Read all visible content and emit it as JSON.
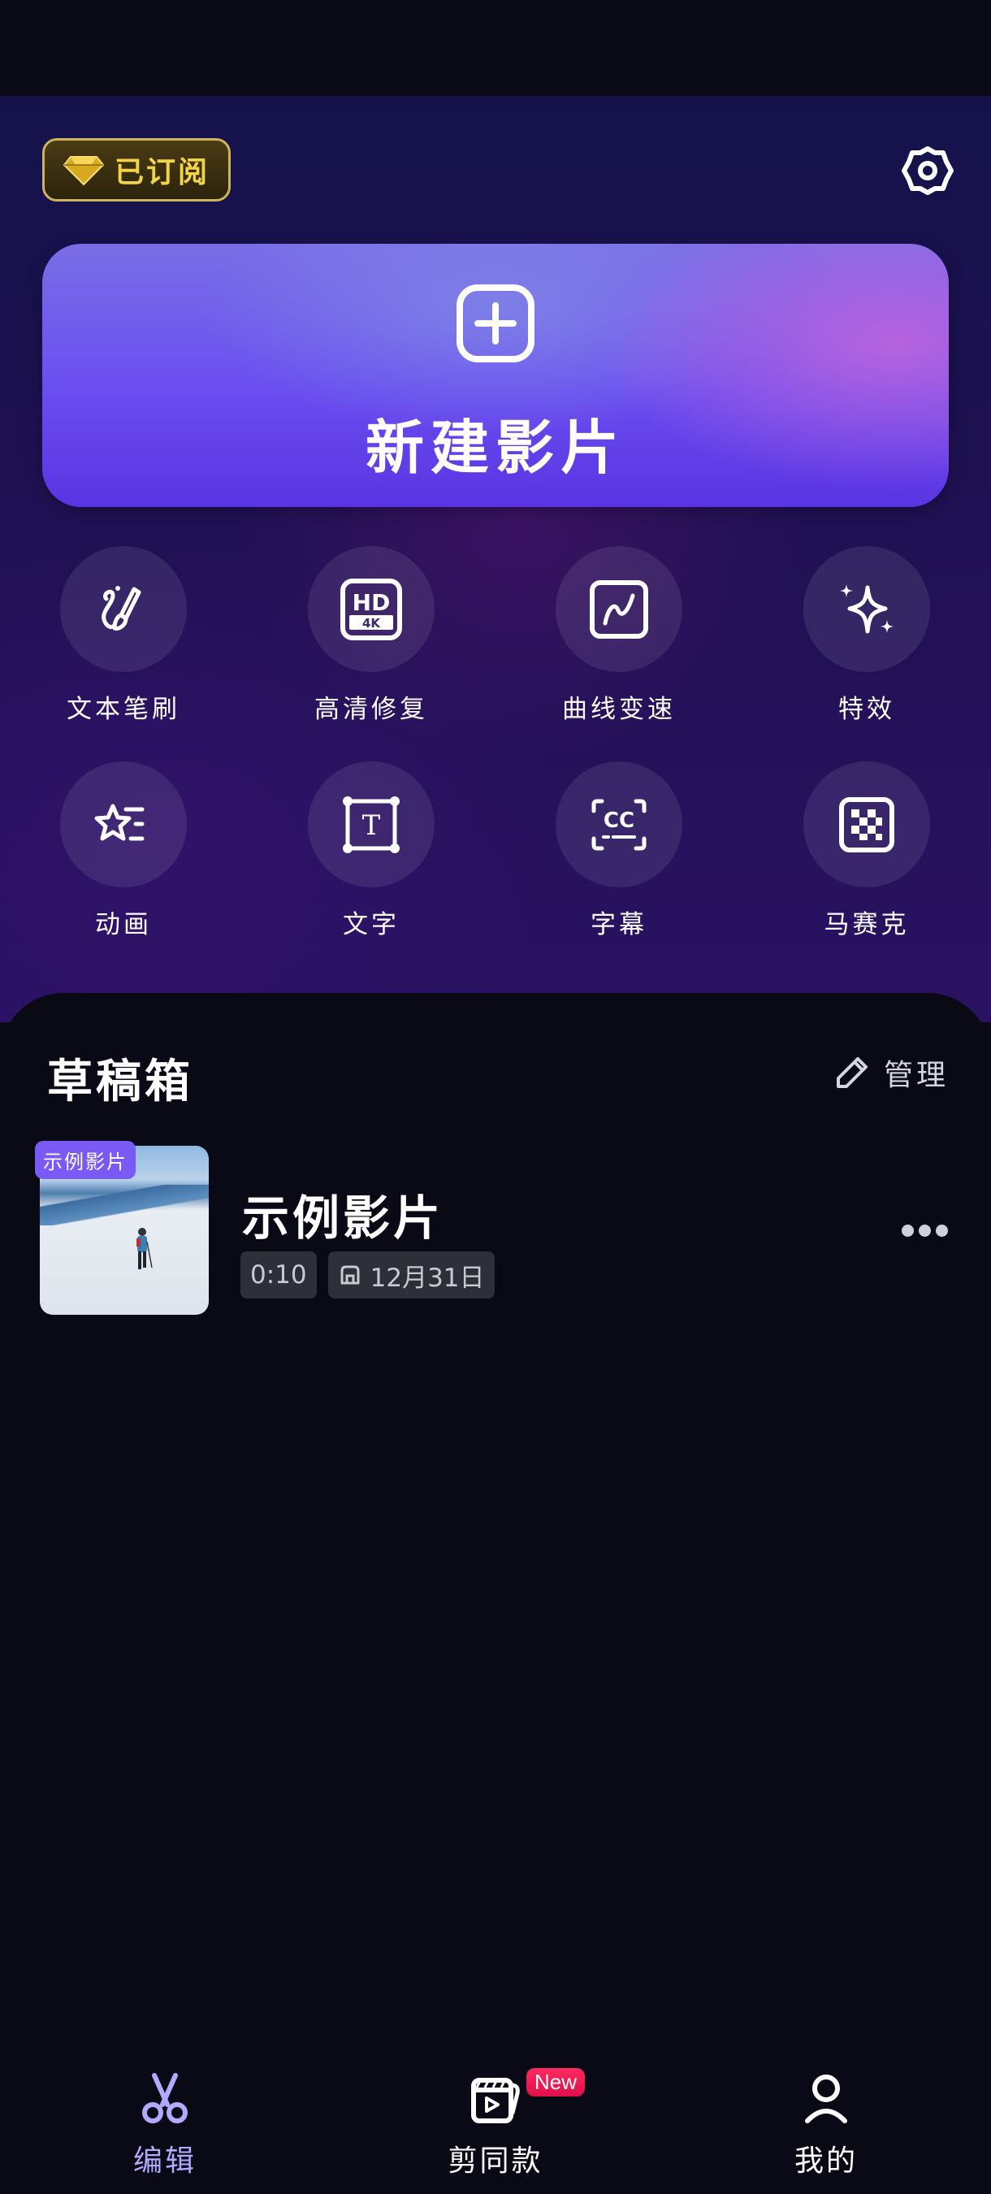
{
  "header": {
    "subscription_badge": "已订阅",
    "settings_icon": "gear-icon"
  },
  "new_project": {
    "label": "新建影片",
    "icon": "plus-square-icon"
  },
  "tools": [
    {
      "label": "文本笔刷",
      "icon": "text-brush-icon"
    },
    {
      "label": "高清修复",
      "icon": "hd-4k-icon"
    },
    {
      "label": "曲线变速",
      "icon": "curve-speed-icon"
    },
    {
      "label": "特效",
      "icon": "sparkle-icon"
    },
    {
      "label": "动画",
      "icon": "star-animation-icon"
    },
    {
      "label": "文字",
      "icon": "text-box-icon"
    },
    {
      "label": "字幕",
      "icon": "closed-caption-icon"
    },
    {
      "label": "马赛克",
      "icon": "mosaic-icon"
    }
  ],
  "drafts": {
    "heading": "草稿箱",
    "manage_label": "管理",
    "items": [
      {
        "tag": "示例影片",
        "title": "示例影片",
        "duration": "0:10",
        "saved_date": "12月31日"
      }
    ]
  },
  "tabbar": {
    "tabs": [
      {
        "label": "编辑",
        "icon": "scissors-icon",
        "active": true
      },
      {
        "label": "剪同款",
        "icon": "template-clapper-icon",
        "active": false,
        "badge": "New"
      },
      {
        "label": "我的",
        "icon": "user-icon",
        "active": false
      }
    ]
  },
  "colors": {
    "accent": "#b3a9ff",
    "tag_purple": "#7a5af5",
    "badge_red": "#f01852",
    "gold": "#f3d34a"
  }
}
